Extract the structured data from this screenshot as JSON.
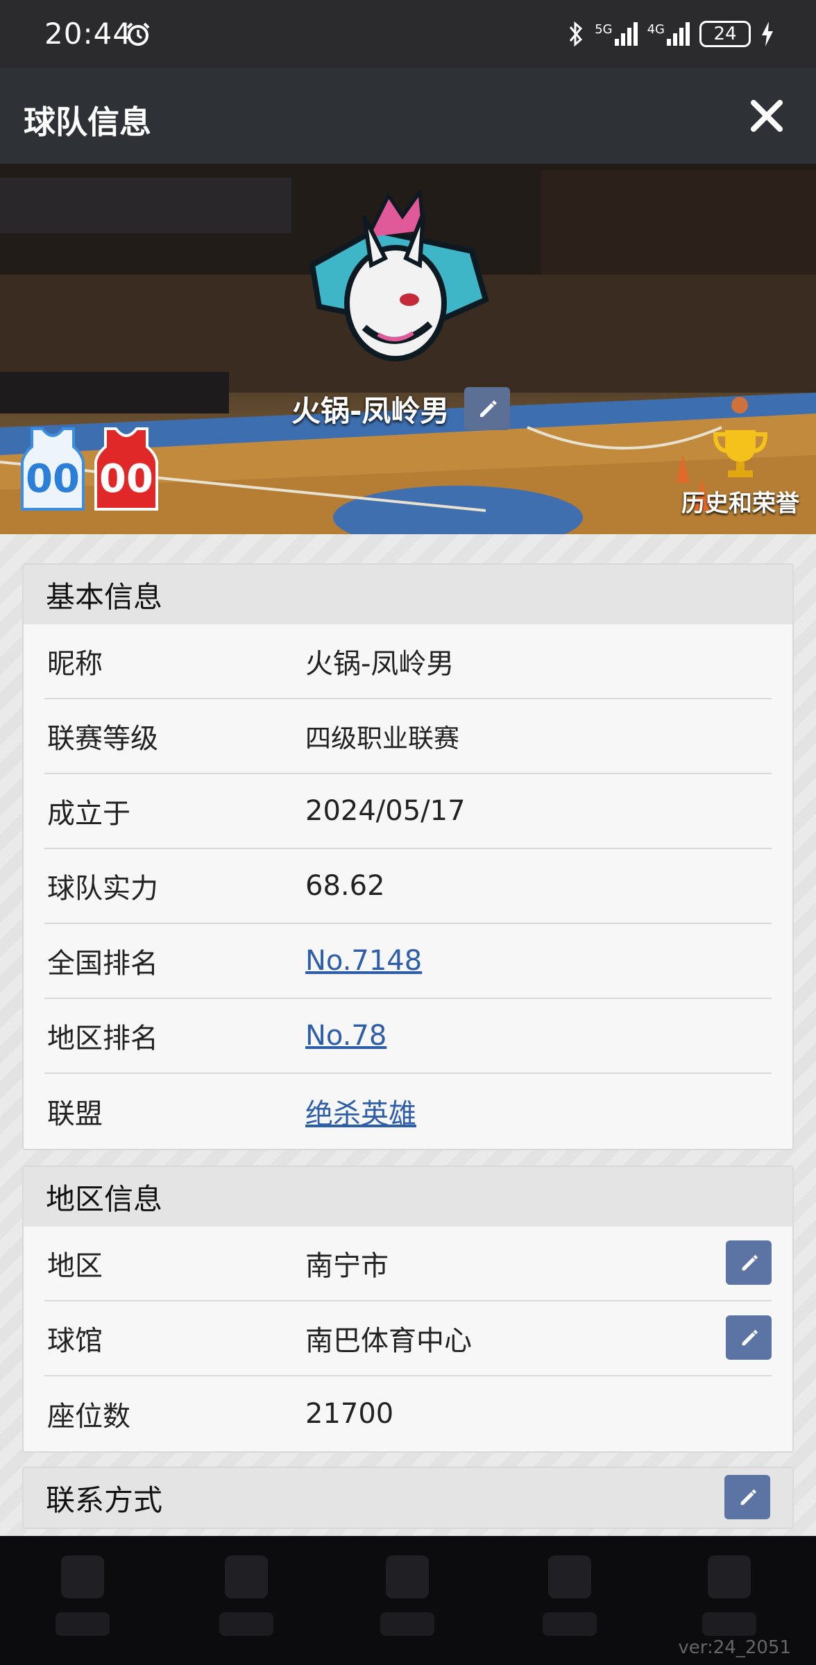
{
  "status_bar": {
    "time": "20:44",
    "battery": "24",
    "net1": "5G",
    "net2": "4G"
  },
  "header": {
    "title": "球队信息"
  },
  "banner": {
    "team_name": "火锅-凤岭男",
    "jersey_home_number": "00",
    "jersey_away_number": "00",
    "honor_label": "历史和荣誉"
  },
  "basic_info": {
    "title": "基本信息",
    "nickname_label": "昵称",
    "nickname": "火锅-凤岭男",
    "league_level_label": "联赛等级",
    "league_level": "四级职业联赛",
    "founded_label": "成立于",
    "founded": "2024/05/17",
    "strength_label": "球队实力",
    "strength": "68.62",
    "national_rank_label": "全国排名",
    "national_rank": "No.7148",
    "regional_rank_label": "地区排名",
    "regional_rank": "No.78",
    "alliance_label": "联盟",
    "alliance": "绝杀英雄"
  },
  "region_info": {
    "title": "地区信息",
    "region_label": "地区",
    "region": "南宁市",
    "arena_label": "球馆",
    "arena": "南巴体育中心",
    "seats_label": "座位数",
    "seats": "21700"
  },
  "contact": {
    "title": "联系方式"
  },
  "footer": {
    "version": "ver:24_2051"
  },
  "colors": {
    "accent": "#5c74a4",
    "link": "#2f5ea8",
    "title_bar": "#2e3136",
    "logo_teal": "#3fb6c8",
    "logo_pink": "#e05a9a"
  }
}
